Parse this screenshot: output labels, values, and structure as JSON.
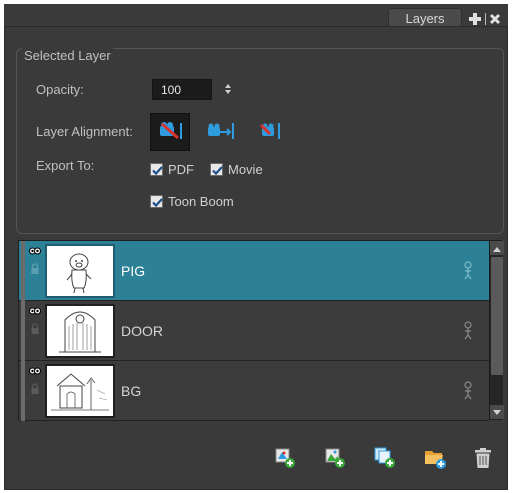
{
  "window": {
    "tab_label": "Layers",
    "tab_tools": [
      "add-icon",
      "close-icon"
    ]
  },
  "selected_layer": {
    "group_title": "Selected Layer",
    "opacity_label": "Opacity:",
    "opacity_value": "100",
    "alignment_label": "Layer Alignment:",
    "alignment_options": [
      "align-left-icon",
      "align-center-icon",
      "align-right-icon"
    ],
    "alignment_selected": 0,
    "export_label": "Export To:",
    "export_options": [
      {
        "label": "PDF",
        "checked": true
      },
      {
        "label": "Movie",
        "checked": true
      },
      {
        "label": "Toon Boom",
        "checked": true
      }
    ]
  },
  "layers": [
    {
      "name": "PIG",
      "selected": true,
      "visible": true
    },
    {
      "name": "DOOR",
      "selected": false,
      "visible": true
    },
    {
      "name": "BG",
      "selected": false,
      "visible": true
    }
  ],
  "toolbar": {
    "buttons": [
      "add-layer-icon",
      "add-image-layer-icon",
      "duplicate-layer-icon",
      "add-folder-icon",
      "delete-icon"
    ]
  },
  "colors": {
    "panel": "#3a3a3a",
    "selected_row": "#2d8197",
    "accent_blue": "#2f9ce0",
    "accent_red": "#d8322c",
    "folder_orange": "#e8a030"
  }
}
